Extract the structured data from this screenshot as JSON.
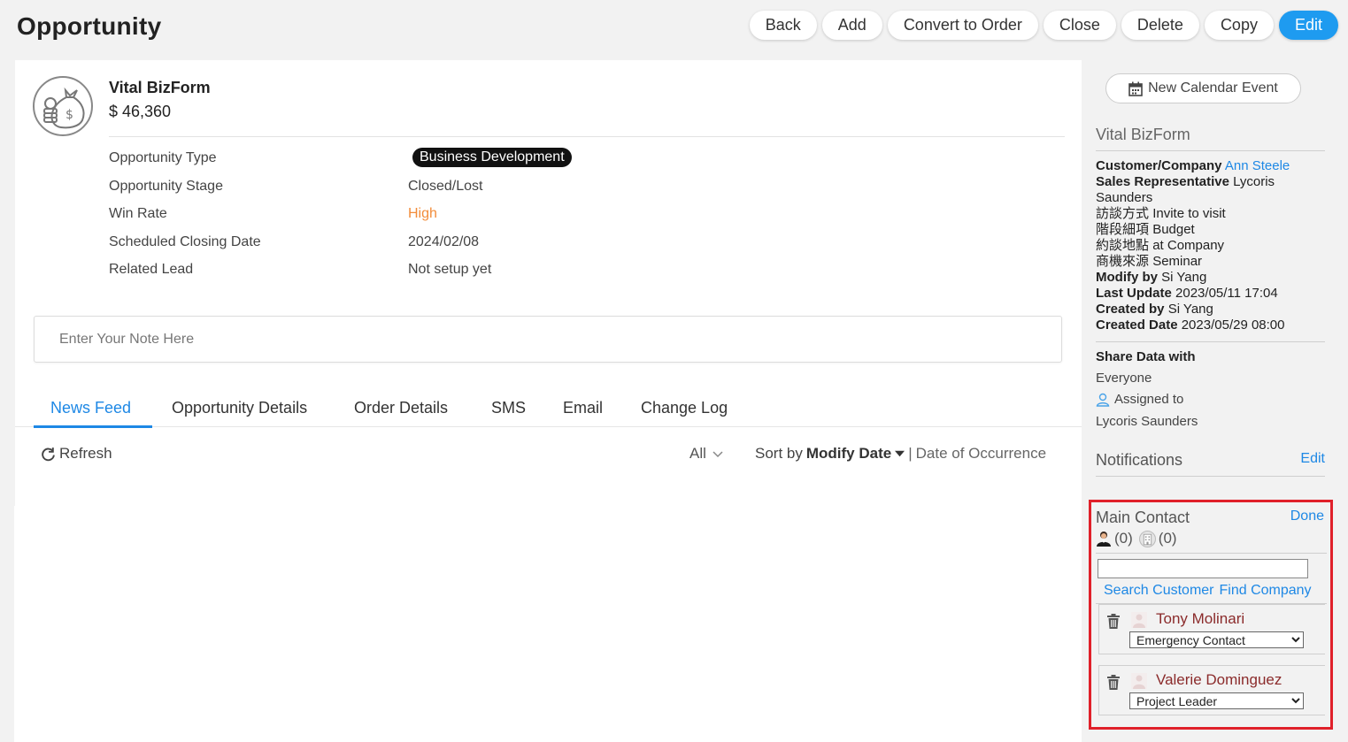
{
  "header": {
    "title": "Opportunity"
  },
  "toolbar": {
    "back": "Back",
    "add": "Add",
    "convert": "Convert to Order",
    "close": "Close",
    "delete": "Delete",
    "copy": "Copy",
    "edit": "Edit"
  },
  "opportunity": {
    "name": "Vital BizForm",
    "amount": "$ 46,360",
    "fields": [
      {
        "label": "Opportunity Type",
        "value": "Business Development"
      },
      {
        "label": "Opportunity Stage",
        "value": "Closed/Lost"
      },
      {
        "label": "Win Rate",
        "value": "High"
      },
      {
        "label": "Scheduled Closing Date",
        "value": "2024/02/08"
      },
      {
        "label": "Related Lead",
        "value": "Not setup yet"
      }
    ]
  },
  "note": {
    "placeholder": "Enter Your Note Here"
  },
  "tabs": [
    "News Feed",
    "Opportunity Details",
    "Order Details",
    "SMS",
    "Email",
    "Change Log"
  ],
  "feed": {
    "refresh": "Refresh",
    "filter": "All",
    "sort_prefix": "Sort by",
    "sort_field": "Modify Date",
    "sort_sep": "|",
    "sort_alt": "Date of Occurrence"
  },
  "sidebar": {
    "calendar_button": "New Calendar Event",
    "title": "Vital BizForm",
    "info": [
      {
        "label": "Customer/Company",
        "value": "Ann Steele"
      },
      {
        "label": "Sales Representative",
        "value": "Lycoris Saunders"
      },
      {
        "label": "訪談方式",
        "value": "Invite to visit"
      },
      {
        "label": "階段細項",
        "value": "Budget"
      },
      {
        "label": "約談地點",
        "value": "at Company"
      },
      {
        "label": "商機來源",
        "value": "Seminar"
      },
      {
        "label": "Modify by",
        "value": "Si Yang"
      },
      {
        "label": "Last Update",
        "value": "2023/05/11 17:04"
      },
      {
        "label": "Created by",
        "value": "Si Yang"
      },
      {
        "label": "Created Date",
        "value": "2023/05/29 08:00"
      }
    ],
    "share_title": "Share Data with",
    "share_value": "Everyone",
    "assigned_label": "Assigned to",
    "assigned_name": "Lycoris Saunders",
    "notifications": "Notifications",
    "notifications_edit": "Edit"
  },
  "main_contact": {
    "title": "Main Contact",
    "done": "Done",
    "person_count": "(0)",
    "company_count": "(0)",
    "search_customer": "Search Customer",
    "find_company": "Find Company",
    "contacts": [
      {
        "name": "Tony Molinari",
        "role": "Emergency Contact"
      },
      {
        "name": "Valerie Dominguez",
        "role": "Project Leader"
      }
    ]
  },
  "colors": {
    "accent": "#1e88e5",
    "edit_button": "#1e9bf0",
    "win_rate": "#f28c3a",
    "contact_name": "#8b2b2b",
    "highlight_border": "#e0202a"
  }
}
